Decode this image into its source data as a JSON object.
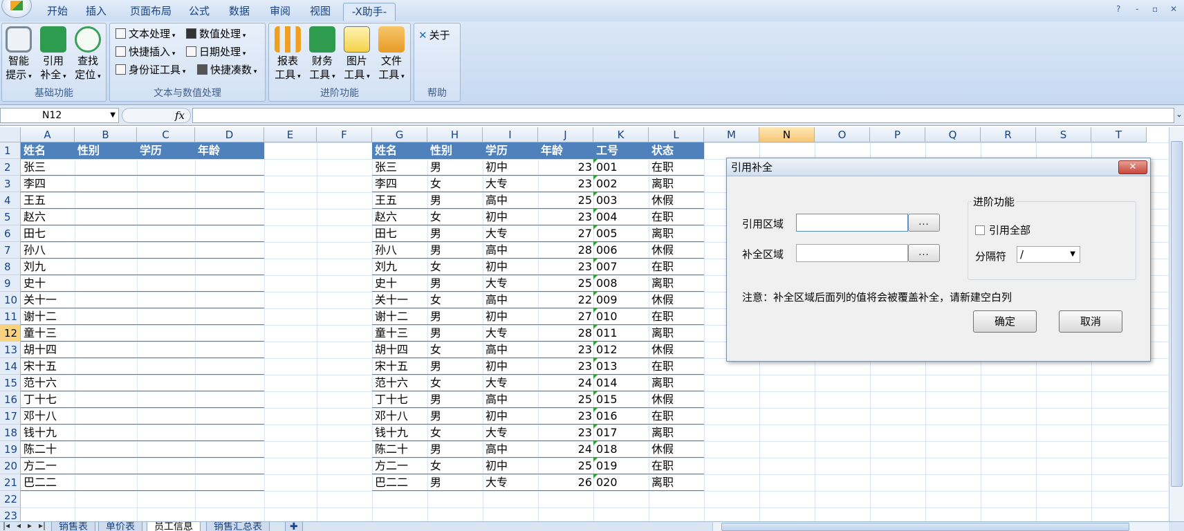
{
  "ribbon": {
    "tabs": [
      "开始",
      "插入",
      "页面布局",
      "公式",
      "数据",
      "审阅",
      "视图",
      "-X助手-"
    ],
    "active_tab": "-X助手-",
    "window_controls": [
      "?",
      "-",
      "▫",
      "✕"
    ],
    "groups": {
      "basic": {
        "label": "基础功能",
        "buttons": [
          {
            "line1": "智能",
            "line2": "提示",
            "icon": "smart-tip-icon"
          },
          {
            "line1": "引用",
            "line2": "补全",
            "icon": "ref-fill-icon"
          },
          {
            "line1": "查找",
            "line2": "定位",
            "icon": "find-locate-icon"
          }
        ]
      },
      "text": {
        "label": "文本与数值处理",
        "items": [
          "文本处理",
          "快捷插入",
          "身份证工具",
          "数值处理",
          "日期处理",
          "快捷凑数"
        ]
      },
      "advanced": {
        "label": "进阶功能",
        "buttons": [
          {
            "line1": "报表",
            "line2": "工具",
            "icon": "report-tool-icon"
          },
          {
            "line1": "财务",
            "line2": "工具",
            "icon": "finance-tool-icon"
          },
          {
            "line1": "图片",
            "line2": "工具",
            "icon": "image-tool-icon"
          },
          {
            "line1": "文件",
            "line2": "工具",
            "icon": "file-tool-icon"
          }
        ]
      },
      "help": {
        "label": "帮助",
        "button": "关于"
      }
    }
  },
  "formula_bar": {
    "name_box": "N12",
    "fx": "fx",
    "formula": ""
  },
  "columns": [
    "A",
    "B",
    "C",
    "D",
    "E",
    "F",
    "G",
    "H",
    "I",
    "J",
    "K",
    "L",
    "M",
    "N",
    "O",
    "P",
    "Q",
    "R",
    "S",
    "T"
  ],
  "selected_column": "N",
  "rows": [
    "1",
    "2",
    "3",
    "4",
    "5",
    "6",
    "7",
    "8",
    "9",
    "10",
    "11",
    "12",
    "13",
    "14",
    "15",
    "16",
    "17",
    "18",
    "19",
    "20",
    "21",
    "22",
    "23"
  ],
  "selected_row": "12",
  "left_table": {
    "headers": [
      "姓名",
      "性别",
      "学历",
      "年龄"
    ],
    "names": [
      "张三",
      "李四",
      "王五",
      "赵六",
      "田七",
      "孙八",
      "刘九",
      "史十",
      "关十一",
      "谢十二",
      "童十三",
      "胡十四",
      "宋十五",
      "范十六",
      "丁十七",
      "邓十八",
      "钱十九",
      "陈二十",
      "方二一",
      "巴二二"
    ]
  },
  "right_table": {
    "headers": [
      "姓名",
      "性别",
      "学历",
      "年龄",
      "工号",
      "状态"
    ],
    "rows": [
      [
        "张三",
        "男",
        "初中",
        "23",
        "001",
        "在职"
      ],
      [
        "李四",
        "女",
        "大专",
        "23",
        "002",
        "离职"
      ],
      [
        "王五",
        "男",
        "高中",
        "25",
        "003",
        "休假"
      ],
      [
        "赵六",
        "女",
        "初中",
        "23",
        "004",
        "在职"
      ],
      [
        "田七",
        "男",
        "大专",
        "27",
        "005",
        "离职"
      ],
      [
        "孙八",
        "男",
        "高中",
        "28",
        "006",
        "休假"
      ],
      [
        "刘九",
        "女",
        "初中",
        "23",
        "007",
        "在职"
      ],
      [
        "史十",
        "男",
        "大专",
        "25",
        "008",
        "离职"
      ],
      [
        "关十一",
        "女",
        "高中",
        "22",
        "009",
        "休假"
      ],
      [
        "谢十二",
        "男",
        "初中",
        "27",
        "010",
        "在职"
      ],
      [
        "童十三",
        "男",
        "大专",
        "28",
        "011",
        "离职"
      ],
      [
        "胡十四",
        "女",
        "高中",
        "23",
        "012",
        "休假"
      ],
      [
        "宋十五",
        "男",
        "初中",
        "23",
        "013",
        "在职"
      ],
      [
        "范十六",
        "女",
        "大专",
        "24",
        "014",
        "离职"
      ],
      [
        "丁十七",
        "男",
        "高中",
        "25",
        "015",
        "休假"
      ],
      [
        "邓十八",
        "男",
        "初中",
        "23",
        "016",
        "在职"
      ],
      [
        "钱十九",
        "女",
        "大专",
        "23",
        "017",
        "离职"
      ],
      [
        "陈二十",
        "男",
        "高中",
        "24",
        "018",
        "休假"
      ],
      [
        "方二一",
        "女",
        "初中",
        "25",
        "019",
        "在职"
      ],
      [
        "巴二二",
        "男",
        "大专",
        "26",
        "020",
        "离职"
      ]
    ]
  },
  "sheet_tabs": [
    "销售表",
    "单价表",
    "员工信息",
    "销售汇总表"
  ],
  "active_sheet": "员工信息",
  "dialog": {
    "title": "引用补全",
    "close": "✕",
    "ref_label": "引用区域",
    "fill_label": "补全区域",
    "browse": "...",
    "advanced_legend": "进阶功能",
    "ref_all_label": "引用全部",
    "separator_label": "分隔符",
    "separator_value": "/",
    "note": "注意：补全区域后面列的值将会被覆盖补全，请新建空白列",
    "ok": "确定",
    "cancel": "取消"
  },
  "colors": {
    "header_blue": "#4f81bd",
    "ribbon_text": "#15428b",
    "selected_header": "#f8c776",
    "dialog_close": "#c9473a"
  }
}
